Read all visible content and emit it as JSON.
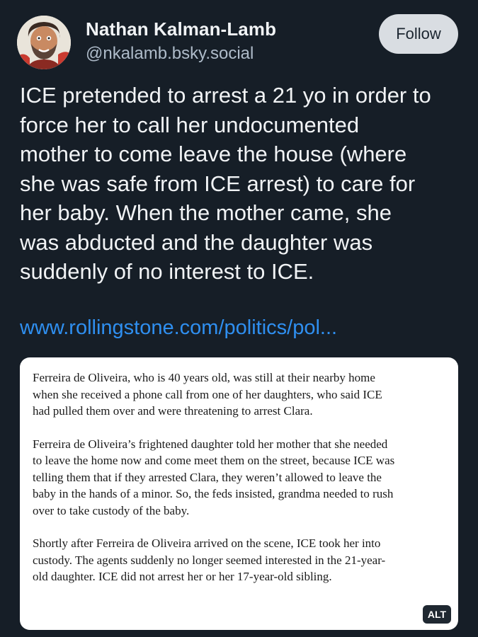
{
  "author": {
    "display_name": "Nathan Kalman-Lamb",
    "handle": "@nkalamb.bsky.social",
    "avatar_icon": "avatar-portrait-icon"
  },
  "follow_button": {
    "label": "Follow"
  },
  "post": {
    "lines": [
      "ICE pretended to arrest a 21 yo in order to",
      "force her to call her undocumented",
      "mother to come leave the house (where",
      "she was safe from ICE arrest) to care for",
      "her baby. When the mother came, she",
      "was abducted and the daughter was",
      "suddenly of no interest to ICE."
    ],
    "link_text": "www.rollingstone.com/politics/pol..."
  },
  "quote_image": {
    "paragraphs": [
      {
        "lines": [
          "Ferreira de Oliveira, who is 40 years old, was still at their nearby home",
          "when she received a phone call from one of her daughters, who said ICE",
          "had pulled them over and were threatening to arrest Clara."
        ]
      },
      {
        "lines": [
          "Ferreira de Oliveira’s frightened daughter told her mother that she needed",
          "to leave the home now and come meet them on the street, because ICE was",
          "telling them that if they arrested Clara, they weren’t allowed to leave the",
          "baby in the hands of a minor. So, the feds insisted, grandma needed to rush",
          "over to take custody of the baby."
        ]
      },
      {
        "lines": [
          "Shortly after Ferreira de Oliveira arrived on the scene, ICE took her into",
          "custody. The agents suddenly no longer seemed interested in the 21-year-",
          "old daughter. ICE did not arrest her or her 17-year-old sibling."
        ]
      }
    ],
    "alt_badge": "ALT"
  },
  "colors": {
    "background": "#161e27",
    "link": "#2f8ff0",
    "handle": "#aebbc9",
    "follow_bg": "#d9dde2"
  }
}
